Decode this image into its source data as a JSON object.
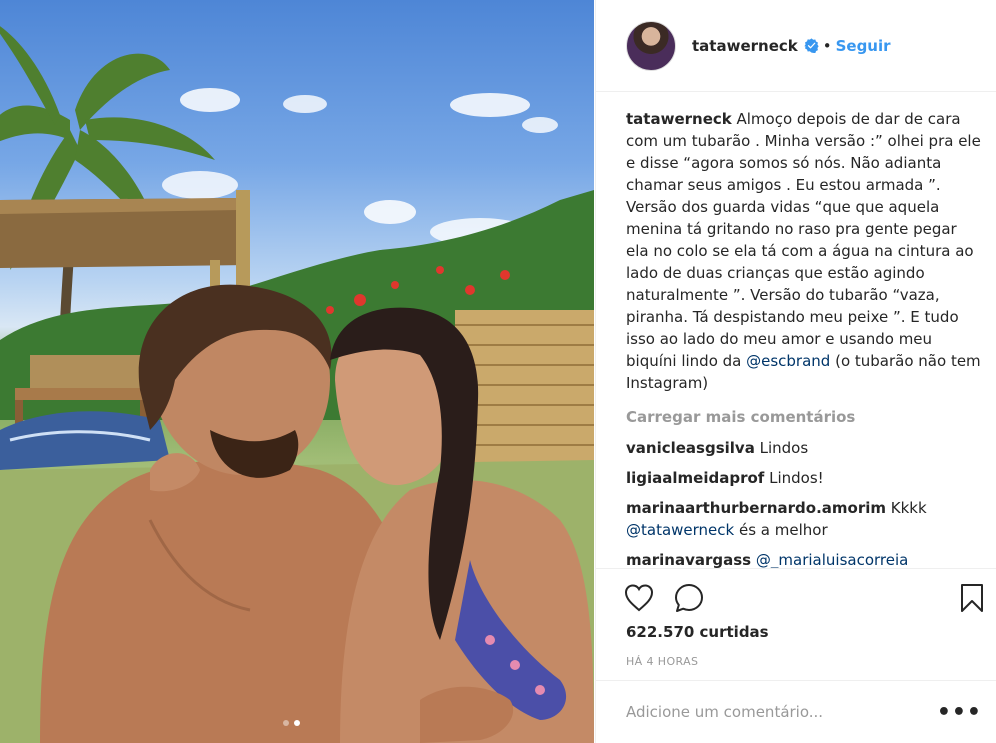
{
  "post": {
    "photo_alt": "",
    "carousel_count": 2,
    "carousel_active": 1
  },
  "header": {
    "username": "tatawerneck",
    "separator": "•",
    "follow_label": "Seguir"
  },
  "caption": {
    "username": "tatawerneck",
    "text_before": " Almoço depois de dar de cara com um tubarão . Minha versão :” olhei pra ele e disse “agora somos só nós. Não adianta chamar seus amigos . Eu estou armada ”. Versão dos guarda vidas “que que aquela menina tá gritando no raso pra gente pegar ela no colo se ela tá com a água na cintura ao lado de duas crianças que estão agindo naturalmente ”. Versão do tubarão “vaza, piranha. Tá despistando meu peixe ”. E tudo isso ao lado do meu amor e usando meu biquíni lindo da ",
    "mention": "@escbrand",
    "text_after": " (o tubarão não tem Instagram)"
  },
  "load_more_label": "Carregar mais comentários",
  "comments": [
    {
      "user": "vanicleasgsilva",
      "text": " Lindos"
    },
    {
      "user": "ligiaalmeidaprof",
      "text": " Lindos!"
    },
    {
      "user": "marinaarthurbernardo.amorim",
      "text": " Kkkk ",
      "mention": "@tatawerneck",
      "after": " és a melhor"
    },
    {
      "user": "marinavargass",
      "text": " ",
      "mention": "@_marialuisacorreia",
      "after": ""
    }
  ],
  "stats": {
    "likes": "622.570 curtidas",
    "time": "HÁ 4 HORAS"
  },
  "add_comment": {
    "placeholder": "Adicione um comentário...",
    "more": "•••"
  },
  "colors": {
    "link": "#3897f0",
    "mention": "#003569",
    "muted": "#999999",
    "border": "#efefef"
  },
  "icons": [
    "verified-badge-icon",
    "heart-icon",
    "comment-icon",
    "bookmark-icon",
    "more-options-icon"
  ]
}
